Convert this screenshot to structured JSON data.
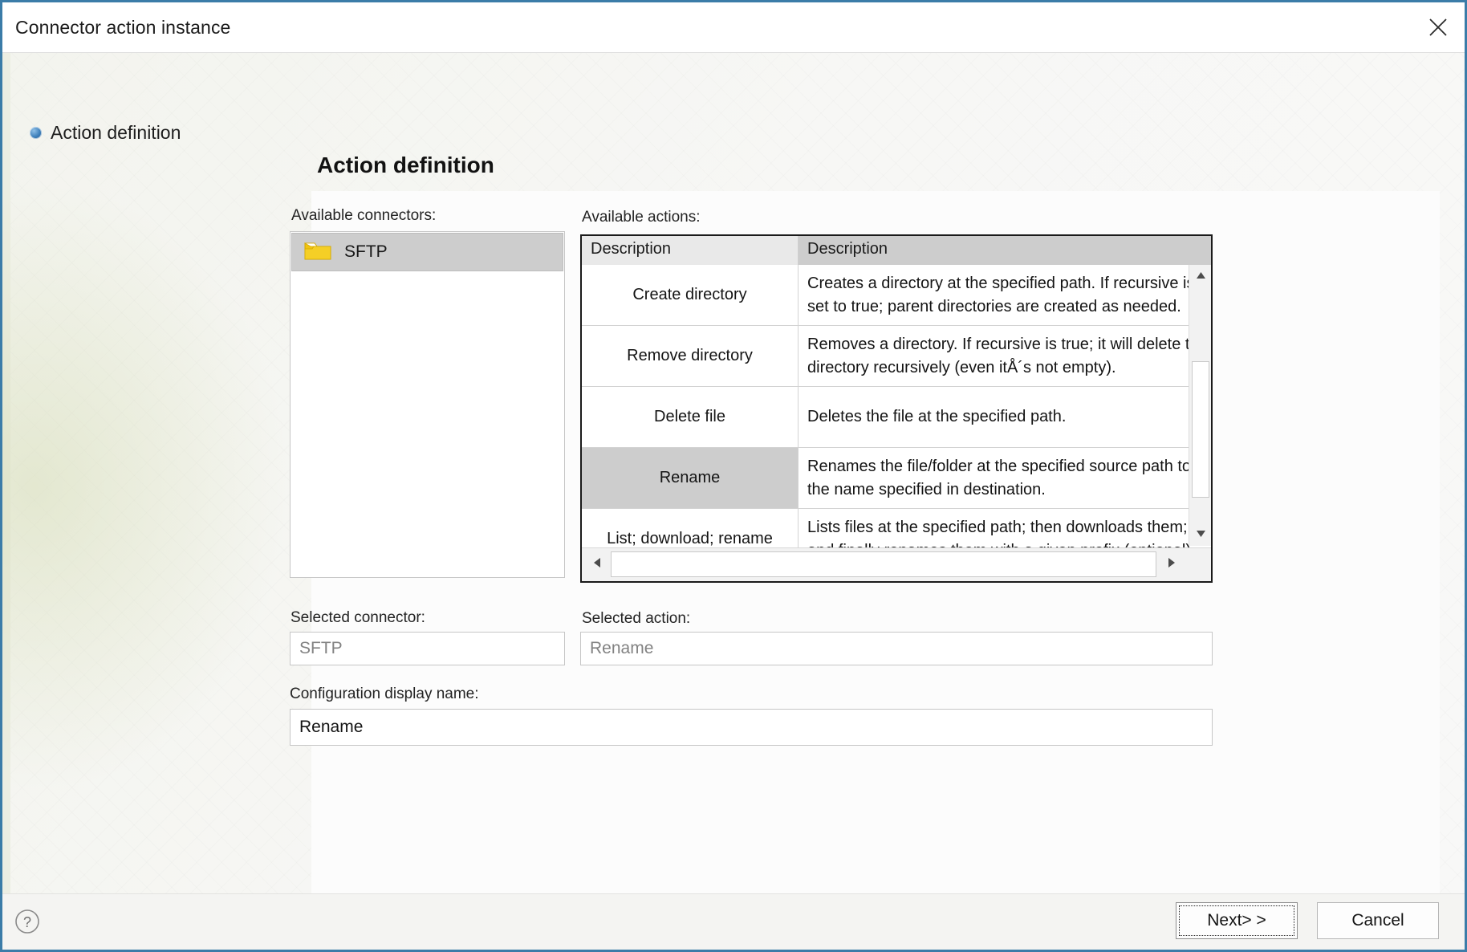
{
  "window": {
    "title": "Connector action instance",
    "close_icon": "close-icon"
  },
  "nav": {
    "items": [
      {
        "label": "Action definition",
        "icon": "bullet-icon",
        "selected": true
      }
    ]
  },
  "main": {
    "page_title": "Action definition",
    "available_connectors_label": "Available connectors:",
    "available_actions_label": "Available actions:",
    "selected_connector_label": "Selected connector:",
    "selected_action_label": "Selected action:",
    "configuration_display_name_label": "Configuration display name:"
  },
  "connectors": {
    "items": [
      {
        "label": "SFTP",
        "icon": "folder-icon",
        "selected": true
      }
    ]
  },
  "actions_table": {
    "columns": [
      "Description",
      "Description"
    ],
    "rows": [
      {
        "name": "Create directory",
        "description": "Creates a directory at the specified path. If recursive is\nset to true; parent directories are created as needed.",
        "selected": false
      },
      {
        "name": "Remove directory",
        "description": "Removes a directory. If recursive is true; it will delete th\ndirectory recursively (even itÅ´s not empty).",
        "selected": false
      },
      {
        "name": "Delete file",
        "description": "Deletes the file at the specified path.",
        "selected": false
      },
      {
        "name": "Rename",
        "description": "Renames the file/folder at the specified source path to\nthe name specified in destination.",
        "selected": true
      },
      {
        "name": "List; download; rename",
        "description": "Lists files at the specified path; then downloads them;\nand finally renames them with a given prefix (optional)",
        "selected": false
      }
    ],
    "scroll_up_icon": "triangle-up-icon",
    "scroll_down_icon": "triangle-down-icon",
    "scroll_left_icon": "triangle-left-icon",
    "scroll_right_icon": "triangle-right-icon"
  },
  "fields": {
    "selected_connector_value": "SFTP",
    "selected_action_value": "Rename",
    "configuration_display_name_value": "Rename"
  },
  "footer": {
    "help_icon": "help-icon",
    "next_label": "Next> >",
    "cancel_label": "Cancel"
  },
  "colors": {
    "window_border": "#3b7ca8",
    "selection": "#cdcdcd",
    "header_accent": "#cdcdcd",
    "folder": "#f2c200"
  }
}
